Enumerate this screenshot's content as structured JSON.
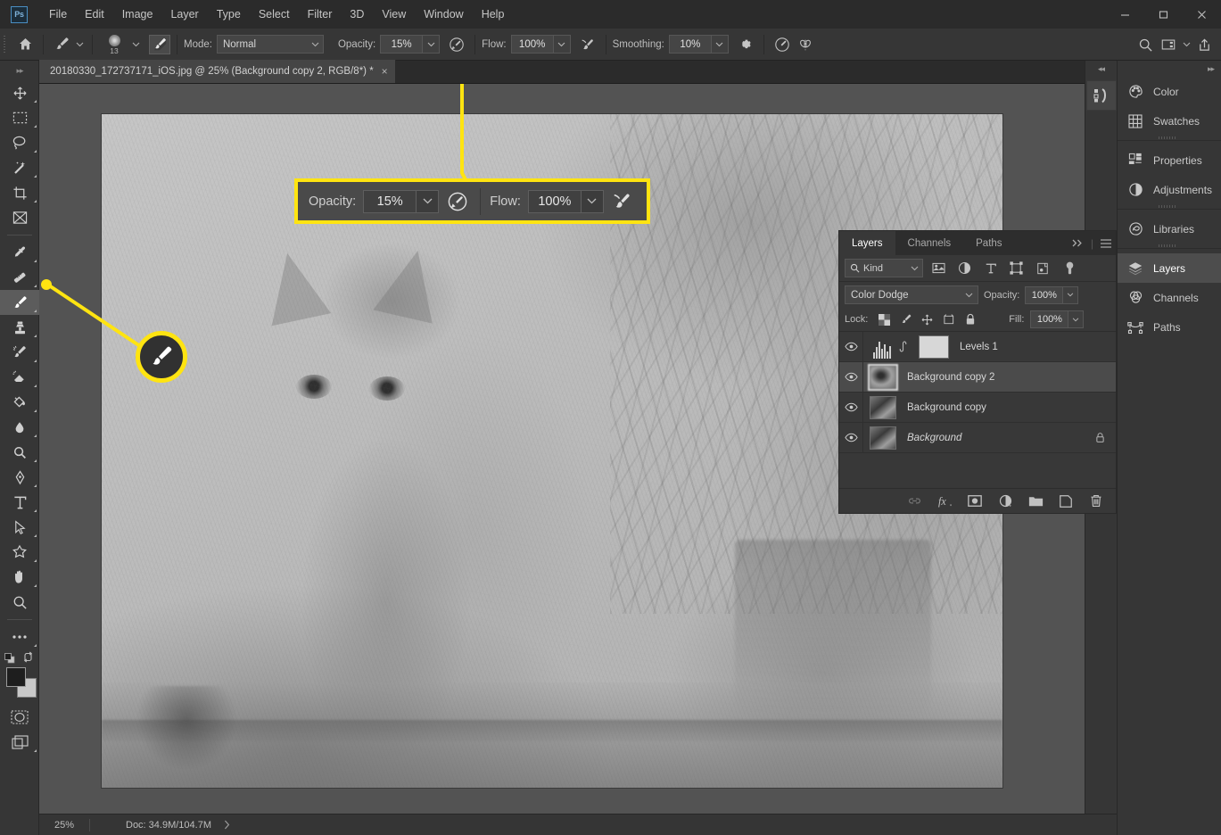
{
  "app": {
    "logo": "Ps"
  },
  "menubar": {
    "items": [
      "File",
      "Edit",
      "Image",
      "Layer",
      "Type",
      "Select",
      "Filter",
      "3D",
      "View",
      "Window",
      "Help"
    ],
    "window_controls": [
      "minimize-button",
      "maximize-button",
      "close-button"
    ]
  },
  "options_bar": {
    "home_icon": "home-icon",
    "brush_preset_icon": "brush-icon",
    "brush_size": "13",
    "brush_panel_icon": "brush-settings-panel-icon",
    "mode_label": "Mode:",
    "mode_value": "Normal",
    "opacity_label": "Opacity:",
    "opacity_value": "15%",
    "opacity_pressure_icon": "pressure-opacity-icon",
    "flow_label": "Flow:",
    "flow_value": "100%",
    "airbrush_icon": "airbrush-icon",
    "smoothing_label": "Smoothing:",
    "smoothing_value": "10%",
    "smoothing_gear_icon": "gear-icon",
    "tablet_pressure_icon": "tablet-pressure-icon",
    "symmetry_icon": "symmetry-butterfly-icon",
    "search_icon": "search-icon",
    "workspace_icon": "workspace-icon",
    "share_icon": "share-icon"
  },
  "toolbar": {
    "tools": [
      {
        "name": "move-tool",
        "icon": "move-icon",
        "has_flyout": true
      },
      {
        "name": "rectangular-marquee-tool",
        "icon": "marquee-icon",
        "has_flyout": true
      },
      {
        "name": "lasso-tool",
        "icon": "lasso-icon",
        "has_flyout": true
      },
      {
        "name": "object-selection-tool",
        "icon": "magic-wand-icon",
        "has_flyout": true
      },
      {
        "name": "crop-tool",
        "icon": "crop-icon",
        "has_flyout": true
      },
      {
        "name": "frame-tool",
        "icon": "frame-icon",
        "has_flyout": false
      },
      {
        "name": "eyedropper-tool",
        "icon": "eyedropper-icon",
        "has_flyout": true
      },
      {
        "name": "healing-brush-tool",
        "icon": "healing-brush-icon",
        "has_flyout": true
      },
      {
        "name": "brush-tool",
        "icon": "brush-icon",
        "has_flyout": true,
        "active": true
      },
      {
        "name": "clone-stamp-tool",
        "icon": "clone-stamp-icon",
        "has_flyout": true
      },
      {
        "name": "history-brush-tool",
        "icon": "history-brush-icon",
        "has_flyout": true
      },
      {
        "name": "eraser-tool",
        "icon": "eraser-icon",
        "has_flyout": true
      },
      {
        "name": "gradient-tool",
        "icon": "paint-bucket-icon",
        "has_flyout": true
      },
      {
        "name": "blur-tool",
        "icon": "water-drop-icon",
        "has_flyout": true
      },
      {
        "name": "dodge-tool",
        "icon": "dodge-icon",
        "has_flyout": true
      },
      {
        "name": "pen-tool",
        "icon": "pen-icon",
        "has_flyout": true
      },
      {
        "name": "type-tool",
        "icon": "type-t-icon",
        "has_flyout": true
      },
      {
        "name": "path-selection-tool",
        "icon": "arrow-cursor-icon",
        "has_flyout": true
      },
      {
        "name": "custom-shape-tool",
        "icon": "star-shape-icon",
        "has_flyout": true
      },
      {
        "name": "hand-tool",
        "icon": "hand-icon",
        "has_flyout": true
      },
      {
        "name": "zoom-tool",
        "icon": "magnifier-icon",
        "has_flyout": false
      },
      {
        "name": "edit-toolbar-button",
        "icon": "ellipsis-icon",
        "has_flyout": true
      }
    ],
    "foreground_color": "#1e1e1e",
    "background_color": "#c8c8c8",
    "default_colors_icon": "default-colors-icon",
    "swap_colors_icon": "swap-colors-icon",
    "quick_mask_icon": "quick-mask-icon",
    "screen_mode_icon": "screen-mode-icon"
  },
  "document": {
    "tab_title": "20180330_172737171_iOS.jpg @ 25% (Background copy 2, RGB/8*) *",
    "close_label": "×"
  },
  "callout": {
    "opacity_label": "Opacity:",
    "opacity_value": "15%",
    "opacity_pressure_icon": "pressure-opacity-icon",
    "flow_label": "Flow:",
    "flow_value": "100%",
    "airbrush_icon": "airbrush-icon",
    "highlight_color": "#ffe411",
    "circled_tool_icon": "brush-icon"
  },
  "mini_panel": {
    "collapse_icon": "double-chevron-left-icon",
    "button_icon": "history-actions-icon"
  },
  "dock_rail": {
    "collapse_icon": "double-chevron-right-icon",
    "groups": [
      [
        {
          "label": "Color",
          "icon": "color-palette-icon",
          "active": false
        },
        {
          "label": "Swatches",
          "icon": "swatches-grid-icon",
          "active": false
        }
      ],
      [
        {
          "label": "Properties",
          "icon": "properties-icon",
          "active": false
        },
        {
          "label": "Adjustments",
          "icon": "adjustments-half-circle-icon",
          "active": false
        }
      ],
      [
        {
          "label": "Libraries",
          "icon": "libraries-icon",
          "active": false
        }
      ],
      [
        {
          "label": "Layers",
          "icon": "layers-stack-icon",
          "active": true
        },
        {
          "label": "Channels",
          "icon": "channels-circles-icon",
          "active": false
        },
        {
          "label": "Paths",
          "icon": "paths-pen-icon",
          "active": false
        }
      ]
    ]
  },
  "layers_panel": {
    "tabs": [
      {
        "label": "Layers",
        "active": true
      },
      {
        "label": "Channels",
        "active": false
      },
      {
        "label": "Paths",
        "active": false
      }
    ],
    "expand_icon": "double-chevron-right-icon",
    "menu_icon": "hamburger-menu-icon",
    "filter": {
      "search_icon": "search-icon",
      "kind_value": "Kind",
      "type_filters": [
        "filter-pixel-icon",
        "filter-adjustment-icon",
        "filter-type-icon",
        "filter-shape-icon",
        "filter-smartobject-icon"
      ],
      "toggle_icon": "filter-power-toggle-icon"
    },
    "blend_mode": "Color Dodge",
    "opacity_label": "Opacity:",
    "opacity_value": "100%",
    "lock_label": "Lock:",
    "lock_icons": [
      "lock-transparent-pixels-icon",
      "lock-image-pixels-icon",
      "lock-position-icon",
      "lock-artboard-icon",
      "lock-all-icon"
    ],
    "fill_label": "Fill:",
    "fill_value": "100%",
    "layers": [
      {
        "name": "Levels 1",
        "type": "adjustment",
        "visible": true,
        "selected": false,
        "locked": false,
        "italic": false
      },
      {
        "name": "Background copy 2",
        "type": "pixel-blurred",
        "visible": true,
        "selected": true,
        "locked": false,
        "italic": false
      },
      {
        "name": "Background copy",
        "type": "pixel",
        "visible": true,
        "selected": false,
        "locked": false,
        "italic": false
      },
      {
        "name": "Background",
        "type": "pixel",
        "visible": true,
        "selected": false,
        "locked": true,
        "italic": true
      }
    ],
    "footer_icons": [
      "link-layers-icon",
      "layer-style-fx-icon",
      "add-layer-mask-icon",
      "new-adjustment-layer-icon",
      "new-group-icon",
      "new-layer-icon",
      "delete-layer-icon"
    ]
  },
  "status_bar": {
    "zoom": "25%",
    "doc_info": "Doc: 34.9M/104.7M",
    "expand_icon": "chevron-right-icon"
  }
}
